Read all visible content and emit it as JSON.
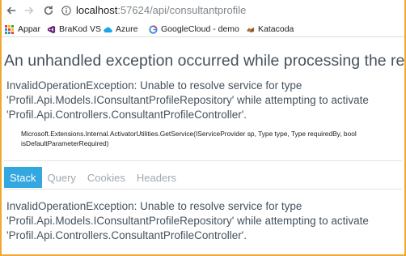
{
  "browser": {
    "url_host": "localhost",
    "url_rest": ":57624/api/consultantprofile",
    "icons": {
      "back": "arrow-left-icon",
      "forward": "arrow-right-icon",
      "reload": "reload-icon",
      "info": "info-icon"
    }
  },
  "bookmarks": [
    {
      "label": "Appar",
      "icon": "apps-grid-icon"
    },
    {
      "label": "BraKod VS",
      "icon": "visual-studio-icon"
    },
    {
      "label": "Azure",
      "icon": "cloud-icon"
    },
    {
      "label": "GoogleCloud - demo",
      "icon": "google-icon"
    },
    {
      "label": "Katacoda",
      "icon": "katacoda-icon"
    }
  ],
  "error_page": {
    "title": "An unhandled exception occurred while processing the request.",
    "message": "InvalidOperationException: Unable to resolve service for type 'Profil.Api.Models.IConsultantProfileRepository' while attempting to activate 'Profil.Api.Controllers.ConsultantProfileController'.",
    "frame": "Microsoft.Extensions.Internal.ActivatorUtilities.GetService(IServiceProvider sp, Type type, Type requiredBy, bool isDefaultParameterRequired)",
    "tabs": [
      "Stack",
      "Query",
      "Cookies",
      "Headers"
    ],
    "active_tab": "Stack",
    "stack_message": "InvalidOperationException: Unable to resolve service for type 'Profil.Api.Models.IConsultantProfileRepository' while attempting to activate 'Profil.Api.Controllers.ConsultantProfileController'."
  },
  "colors": {
    "window_border": "#f0a830",
    "text": "#44525e",
    "tab_active": "#33a7e0",
    "tab_inactive_text": "#a0a8ae"
  }
}
